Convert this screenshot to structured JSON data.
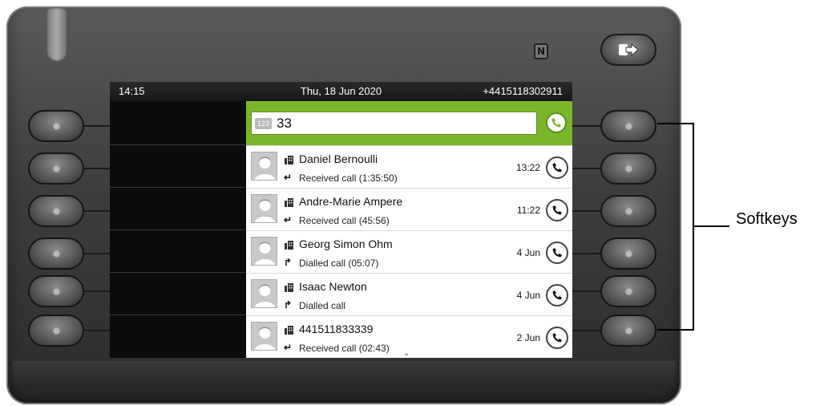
{
  "status_bar": {
    "time": "14:15",
    "date": "Thu, 18 Jun 2020",
    "own_number": "+4415118302911"
  },
  "dial": {
    "mode_badge": "123",
    "value": "33"
  },
  "call_list": [
    {
      "name": "Daniel Bernoulli",
      "detail": "Received call (1:35:50)",
      "time": "13:22",
      "direction": "received"
    },
    {
      "name": "Andre-Marie Ampere",
      "detail": "Received call (45:56)",
      "time": "11:22",
      "direction": "received"
    },
    {
      "name": "Georg Simon Ohm",
      "detail": "Dialled call (05:07)",
      "time": "4 Jun",
      "direction": "dialled"
    },
    {
      "name": "Isaac Newton",
      "detail": "Dialled call",
      "time": "4 Jun",
      "direction": "dialled"
    },
    {
      "name": "441511833339",
      "detail": "Received call (02:43)",
      "time": "2 Jun",
      "direction": "received"
    }
  ],
  "annotation": {
    "softkeys_label": "Softkeys"
  },
  "colors": {
    "accent_green": "#7ab629",
    "housing": "#3e3e3e"
  }
}
